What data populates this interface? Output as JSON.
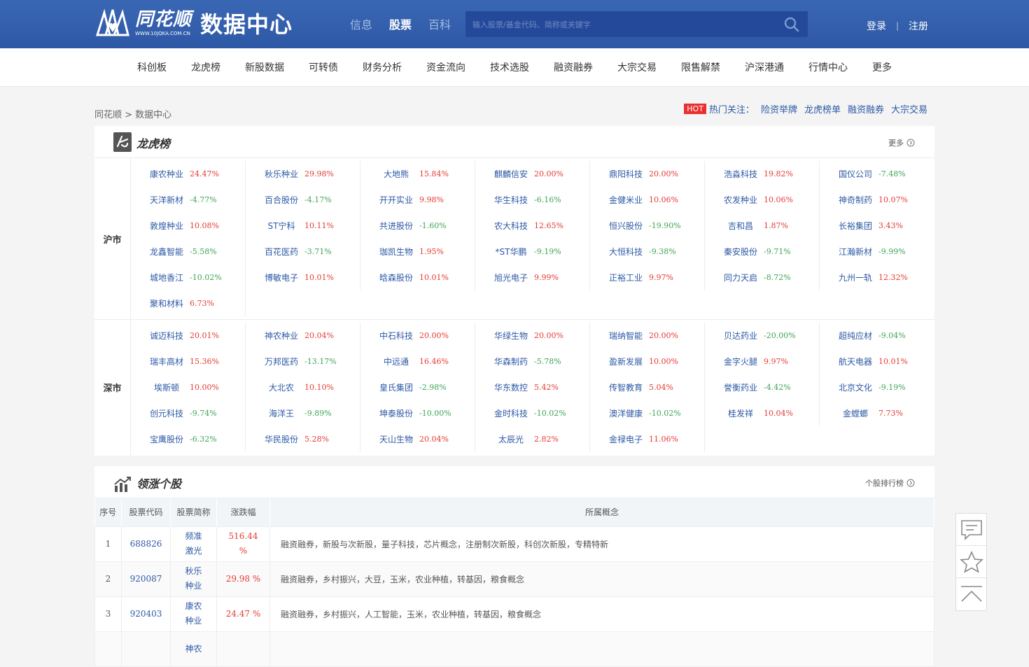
{
  "brand": {
    "name": "同花顺",
    "url": "WWW.10JQKA.COM.CN",
    "title": "数据中心"
  },
  "topnav": [
    {
      "label": "信息",
      "active": false
    },
    {
      "label": "股票",
      "active": true
    },
    {
      "label": "百科",
      "active": false
    }
  ],
  "search": {
    "placeholder": "输入股票/基金代码、简称或关键字"
  },
  "auth": {
    "login": "登录",
    "sep": "|",
    "register": "注册"
  },
  "subnav": [
    "科创板",
    "龙虎榜",
    "新股数据",
    "可转债",
    "财务分析",
    "资金流向",
    "技术选股",
    "融资融券",
    "大宗交易",
    "限售解禁",
    "沪深港通",
    "行情中心",
    "更多"
  ],
  "breadcrumb": "同花顺 > 数据中心",
  "hot": {
    "badge": "HOT",
    "label": "热门关注：",
    "links": [
      "险资举牌",
      "龙虎榜单",
      "融资融券",
      "大宗交易"
    ]
  },
  "dragon": {
    "title": "龙虎榜",
    "more": "更多",
    "markets": [
      {
        "label": "沪市",
        "stocks": [
          {
            "name": "康农种业",
            "pct": "24.47%",
            "dir": "up"
          },
          {
            "name": "秋乐种业",
            "pct": "29.98%",
            "dir": "up"
          },
          {
            "name": "大地熊",
            "pct": "15.84%",
            "dir": "up"
          },
          {
            "name": "麒麟信安",
            "pct": "20.00%",
            "dir": "up"
          },
          {
            "name": "鼎阳科技",
            "pct": "20.00%",
            "dir": "up"
          },
          {
            "name": "浩淼科技",
            "pct": "19.82%",
            "dir": "up"
          },
          {
            "name": "国仪公司",
            "pct": "-7.48%",
            "dir": "down"
          },
          {
            "name": "天洋新材",
            "pct": "-4.77%",
            "dir": "down"
          },
          {
            "name": "百合股份",
            "pct": "-4.17%",
            "dir": "down"
          },
          {
            "name": "开开实业",
            "pct": "9.98%",
            "dir": "up"
          },
          {
            "name": "华生科技",
            "pct": "-6.16%",
            "dir": "down"
          },
          {
            "name": "金健米业",
            "pct": "10.06%",
            "dir": "up"
          },
          {
            "name": "农发种业",
            "pct": "10.06%",
            "dir": "up"
          },
          {
            "name": "神奇制药",
            "pct": "10.07%",
            "dir": "up"
          },
          {
            "name": "敦煌种业",
            "pct": "10.08%",
            "dir": "up"
          },
          {
            "name": "ST宁科",
            "pct": "10.11%",
            "dir": "up"
          },
          {
            "name": "共进股份",
            "pct": "-1.60%",
            "dir": "down"
          },
          {
            "name": "农大科技",
            "pct": "12.65%",
            "dir": "up"
          },
          {
            "name": "恒兴股份",
            "pct": "-19.90%",
            "dir": "down"
          },
          {
            "name": "吉和昌",
            "pct": "1.87%",
            "dir": "up"
          },
          {
            "name": "长裕集团",
            "pct": "3.43%",
            "dir": "up"
          },
          {
            "name": "龙鑫智能",
            "pct": "-5.58%",
            "dir": "down"
          },
          {
            "name": "百花医药",
            "pct": "-3.71%",
            "dir": "down"
          },
          {
            "name": "珈凯生物",
            "pct": "1.95%",
            "dir": "up"
          },
          {
            "name": "*ST华鹏",
            "pct": "-9.19%",
            "dir": "down"
          },
          {
            "name": "大恒科技",
            "pct": "-9.38%",
            "dir": "down"
          },
          {
            "name": "秦安股份",
            "pct": "-9.71%",
            "dir": "down"
          },
          {
            "name": "江瀚新材",
            "pct": "-9.99%",
            "dir": "down"
          },
          {
            "name": "城地香江",
            "pct": "-10.02%",
            "dir": "down"
          },
          {
            "name": "博敏电子",
            "pct": "10.01%",
            "dir": "up"
          },
          {
            "name": "晗森股份",
            "pct": "10.01%",
            "dir": "up"
          },
          {
            "name": "旭光电子",
            "pct": "9.99%",
            "dir": "up"
          },
          {
            "name": "正裕工业",
            "pct": "9.97%",
            "dir": "up"
          },
          {
            "name": "同力天启",
            "pct": "-8.72%",
            "dir": "down"
          },
          {
            "name": "九州一轨",
            "pct": "12.32%",
            "dir": "up"
          },
          {
            "name": "聚和材料",
            "pct": "6.73%",
            "dir": "up"
          }
        ]
      },
      {
        "label": "深市",
        "stocks": [
          {
            "name": "诚迈科技",
            "pct": "20.01%",
            "dir": "up"
          },
          {
            "name": "神农种业",
            "pct": "20.04%",
            "dir": "up"
          },
          {
            "name": "中石科技",
            "pct": "20.00%",
            "dir": "up"
          },
          {
            "name": "华绿生物",
            "pct": "20.00%",
            "dir": "up"
          },
          {
            "name": "瑞纳智能",
            "pct": "20.00%",
            "dir": "up"
          },
          {
            "name": "贝达药业",
            "pct": "-20.00%",
            "dir": "down"
          },
          {
            "name": "超纯应材",
            "pct": "-9.04%",
            "dir": "down"
          },
          {
            "name": "瑞丰高材",
            "pct": "15.36%",
            "dir": "up"
          },
          {
            "name": "万邦医药",
            "pct": "-13.17%",
            "dir": "down"
          },
          {
            "name": "中远通",
            "pct": "16.46%",
            "dir": "up"
          },
          {
            "name": "华森制药",
            "pct": "-5.78%",
            "dir": "down"
          },
          {
            "name": "盈新发展",
            "pct": "10.00%",
            "dir": "up"
          },
          {
            "name": "金字火腿",
            "pct": "9.97%",
            "dir": "up"
          },
          {
            "name": "航天电器",
            "pct": "10.01%",
            "dir": "up"
          },
          {
            "name": "埃斯顿",
            "pct": "10.00%",
            "dir": "up"
          },
          {
            "name": "大北农",
            "pct": "10.10%",
            "dir": "up"
          },
          {
            "name": "皇氏集团",
            "pct": "-2.98%",
            "dir": "down"
          },
          {
            "name": "华东数控",
            "pct": "5.42%",
            "dir": "up"
          },
          {
            "name": "传智教育",
            "pct": "5.04%",
            "dir": "up"
          },
          {
            "name": "誉衡药业",
            "pct": "-4.42%",
            "dir": "down"
          },
          {
            "name": "北京文化",
            "pct": "-9.19%",
            "dir": "down"
          },
          {
            "name": "创元科技",
            "pct": "-9.74%",
            "dir": "down"
          },
          {
            "name": "海洋王",
            "pct": "-9.89%",
            "dir": "down"
          },
          {
            "name": "坤泰股份",
            "pct": "-10.00%",
            "dir": "down"
          },
          {
            "name": "金时科技",
            "pct": "-10.02%",
            "dir": "down"
          },
          {
            "name": "澳洋健康",
            "pct": "-10.02%",
            "dir": "down"
          },
          {
            "name": "桂发祥",
            "pct": "10.04%",
            "dir": "up"
          },
          {
            "name": "金螳螂",
            "pct": "7.73%",
            "dir": "up"
          },
          {
            "name": "宝鹰股份",
            "pct": "-6.32%",
            "dir": "down"
          },
          {
            "name": "华民股份",
            "pct": "5.28%",
            "dir": "up"
          },
          {
            "name": "天山生物",
            "pct": "20.04%",
            "dir": "up"
          },
          {
            "name": "太辰光",
            "pct": "2.82%",
            "dir": "up"
          },
          {
            "name": "金禄电子",
            "pct": "11.06%",
            "dir": "up"
          }
        ]
      }
    ]
  },
  "leaders": {
    "title": "领涨个股",
    "more": "个股排行榜",
    "headers": [
      "序号",
      "股票代码",
      "股票简称",
      "涨跌幅",
      "所属概念"
    ],
    "rows": [
      {
        "no": "1",
        "code": "688826",
        "name1": "频准",
        "name2": "激光",
        "chg1": "516.44",
        "chg2": "%",
        "concept": "融资融券，新股与次新股，量子科技，芯片概念，注册制次新股，科创次新股，专精特新"
      },
      {
        "no": "2",
        "code": "920087",
        "name1": "秋乐",
        "name2": "种业",
        "chg1": "29.98 %",
        "chg2": "",
        "concept": "融资融券，乡村振兴，大豆，玉米，农业种植，转基因，粮食概念"
      },
      {
        "no": "3",
        "code": "920403",
        "name1": "康农",
        "name2": "种业",
        "chg1": "24.47 %",
        "chg2": "",
        "concept": "融资融券，乡村振兴，人工智能，玉米，农业种植，转基因，粮食概念"
      },
      {
        "no": "",
        "code": "",
        "name1": "神农",
        "name2": "",
        "chg1": "",
        "chg2": "",
        "concept": ""
      }
    ]
  },
  "colors": {
    "brand_blue": "#2d58a6",
    "up_red": "#e53b32",
    "down_green": "#3ea556",
    "hot_red": "#e93030"
  },
  "icons": [
    "search-icon",
    "dragon-icon",
    "trend-chart-icon",
    "chevron-right-icon",
    "feedback-icon",
    "star-icon",
    "back-to-top-icon"
  ]
}
